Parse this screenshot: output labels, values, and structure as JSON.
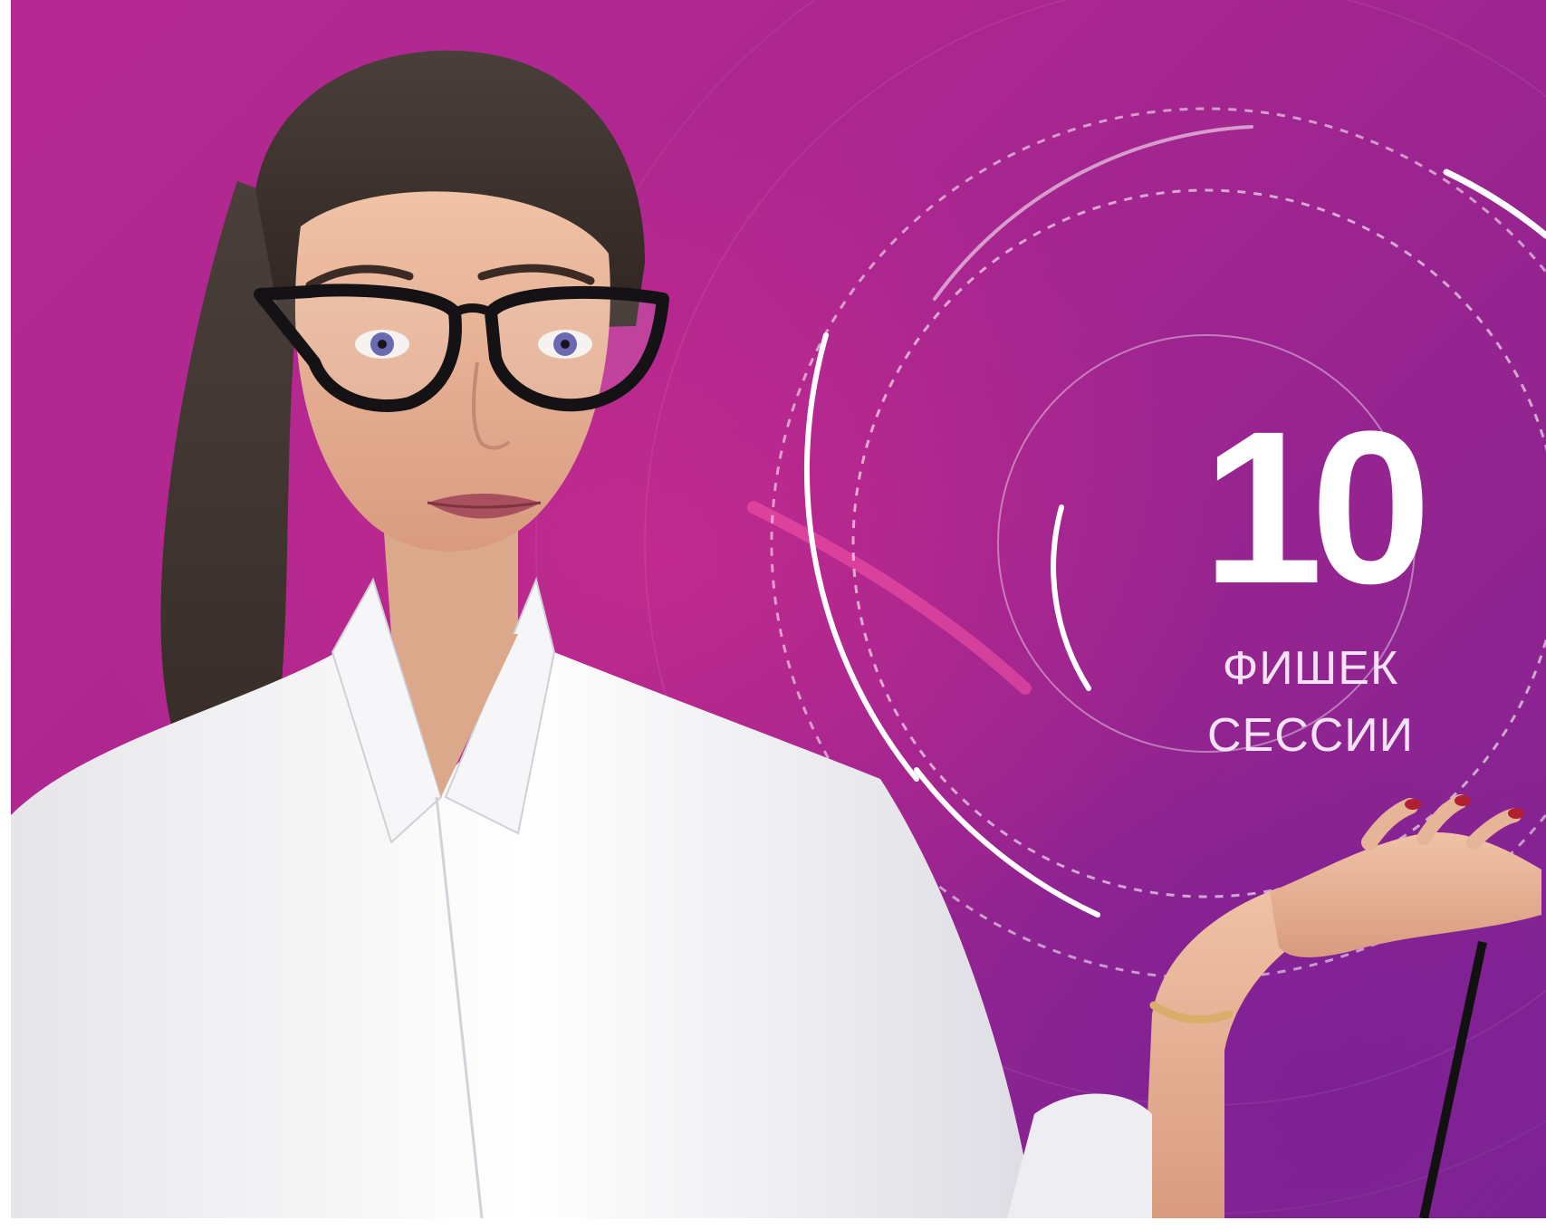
{
  "badge": {
    "number": "10",
    "line1": "ФИШЕК",
    "line2": "СЕССИИ"
  },
  "colors": {
    "background_start": "#b52a92",
    "background_end": "#7e2494",
    "corner_tab": "#2d9ad8",
    "text": "#ffffff"
  },
  "illustration": {
    "subject": "woman-in-glasses-and-white-shirt"
  }
}
